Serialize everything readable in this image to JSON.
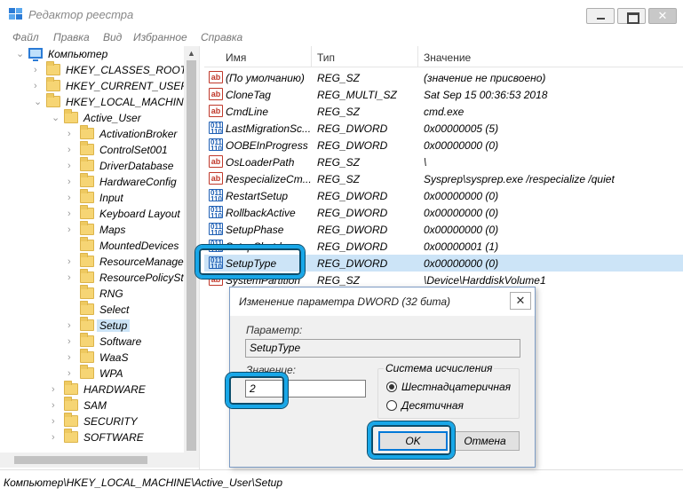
{
  "window": {
    "title": "Редактор реестра",
    "icon": "regedit-icon",
    "close_glyph": "✕"
  },
  "menu": [
    "Файл",
    "Правка",
    "Вид",
    "Избранное",
    "Справка"
  ],
  "tree": {
    "root": "Компьютер",
    "items": [
      {
        "label": "HKEY_CLASSES_ROOT",
        "arrow": "›"
      },
      {
        "label": "HKEY_CURRENT_USER",
        "arrow": "›"
      },
      {
        "label": "HKEY_LOCAL_MACHINE",
        "arrow": "⌄"
      },
      {
        "label": "Active_User",
        "arrow": "⌄"
      },
      {
        "label": "ActivationBroker",
        "arrow": "›"
      },
      {
        "label": "ControlSet001",
        "arrow": "›"
      },
      {
        "label": "DriverDatabase",
        "arrow": "›"
      },
      {
        "label": "HardwareConfig",
        "arrow": "›"
      },
      {
        "label": "Input",
        "arrow": "›"
      },
      {
        "label": "Keyboard Layout",
        "arrow": "›"
      },
      {
        "label": "Maps",
        "arrow": "›"
      },
      {
        "label": "MountedDevices",
        "arrow": ""
      },
      {
        "label": "ResourceManager",
        "arrow": "›"
      },
      {
        "label": "ResourcePolicyStor",
        "arrow": "›"
      },
      {
        "label": "RNG",
        "arrow": ""
      },
      {
        "label": "Select",
        "arrow": ""
      },
      {
        "label": "Setup",
        "arrow": "›"
      },
      {
        "label": "Software",
        "arrow": "›"
      },
      {
        "label": "WaaS",
        "arrow": "›"
      },
      {
        "label": "WPA",
        "arrow": "›"
      },
      {
        "label": "HARDWARE",
        "arrow": "›"
      },
      {
        "label": "SAM",
        "arrow": "›"
      },
      {
        "label": "SECURITY",
        "arrow": "›"
      },
      {
        "label": "SOFTWARE",
        "arrow": "›"
      }
    ]
  },
  "list": {
    "headers": {
      "name": "Имя",
      "type": "Тип",
      "value": "Значение"
    },
    "rows": [
      {
        "name": "(По умолчанию)",
        "type": "REG_SZ",
        "value": "(значение не присвоено)",
        "icon": "ab"
      },
      {
        "name": "CloneTag",
        "type": "REG_MULTI_SZ",
        "value": "Sat Sep 15 00:36:53 2018",
        "icon": "ab"
      },
      {
        "name": "CmdLine",
        "type": "REG_SZ",
        "value": "cmd.exe",
        "icon": "ab"
      },
      {
        "name": "LastMigrationSc...",
        "type": "REG_DWORD",
        "value": "0x00000005 (5)",
        "icon": "dw"
      },
      {
        "name": "OOBEInProgress",
        "type": "REG_DWORD",
        "value": "0x00000000 (0)",
        "icon": "dw"
      },
      {
        "name": "OsLoaderPath",
        "type": "REG_SZ",
        "value": "\\",
        "icon": "ab"
      },
      {
        "name": "RespecializeCm...",
        "type": "REG_SZ",
        "value": "Sysprep\\sysprep.exe /respecialize /quiet",
        "icon": "ab"
      },
      {
        "name": "RestartSetup",
        "type": "REG_DWORD",
        "value": "0x00000000 (0)",
        "icon": "dw"
      },
      {
        "name": "RollbackActive",
        "type": "REG_DWORD",
        "value": "0x00000000 (0)",
        "icon": "dw"
      },
      {
        "name": "SetupPhase",
        "type": "REG_DWORD",
        "value": "0x00000000 (0)",
        "icon": "dw"
      },
      {
        "name": "SetupShutdown",
        "type": "REG_DWORD",
        "value": "0x00000001 (1)",
        "icon": "dw"
      },
      {
        "name": "SetupType",
        "type": "REG_DWORD",
        "value": "0x00000000 (0)",
        "icon": "dw"
      },
      {
        "name": "SystemPartition",
        "type": "REG_SZ",
        "value": "\\Device\\HarddiskVolume1",
        "icon": "ab"
      }
    ]
  },
  "status": "Компьютер\\HKEY_LOCAL_MACHINE\\Active_User\\Setup",
  "dialog": {
    "title": "Изменение параметра DWORD (32 бита)",
    "close_glyph": "✕",
    "param_label": "Параметр:",
    "param_value": "SetupType",
    "value_label": "Значение:",
    "value": "2",
    "base_group": "Система исчисления",
    "hex_label": "Шестнадцатеричная",
    "dec_label": "Десятичная",
    "ok": "OK",
    "cancel": "Отмена"
  },
  "accent_color": "#18a7e8"
}
